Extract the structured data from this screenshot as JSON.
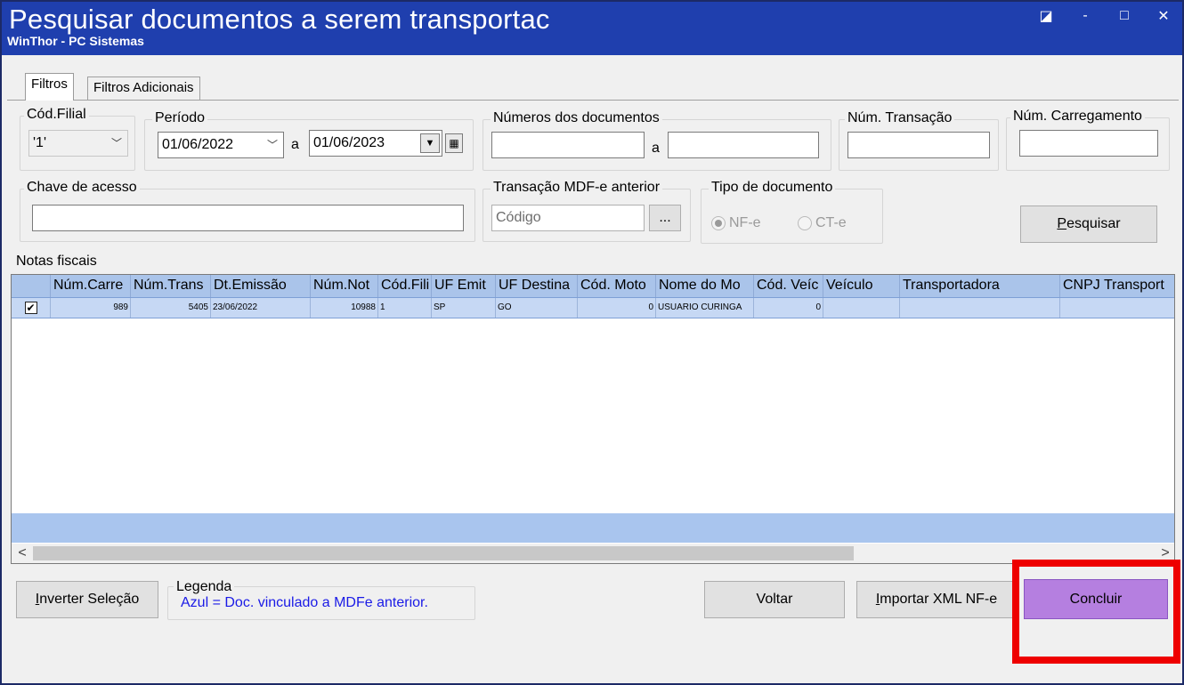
{
  "window": {
    "title": "Pesquisar documentos a serem transportac",
    "subtitle": "WinThor - PC Sistemas",
    "controls": {
      "restore": "◪",
      "minimize": "-",
      "maximize": "□",
      "close": "✕"
    }
  },
  "tabs": [
    {
      "label": "Filtros",
      "active": true
    },
    {
      "label": "Filtros Adicionais",
      "active": false
    }
  ],
  "filters": {
    "filial": {
      "label": "Cód.Filial",
      "value": "'1'"
    },
    "periodo": {
      "label": "Período",
      "start": "01/06/2022",
      "separator": "a",
      "end": "01/06/2023"
    },
    "numeros": {
      "label": "Números dos documentos",
      "from": "",
      "separator": "a",
      "to": ""
    },
    "transacao": {
      "label": "Núm. Transação",
      "value": ""
    },
    "carregamento": {
      "label": "Núm. Carregamento",
      "value": ""
    },
    "chave": {
      "label": "Chave de acesso",
      "value": ""
    },
    "mdfe": {
      "label": "Transação MDF-e anterior",
      "placeholder": "Código",
      "browse": "..."
    },
    "tipo": {
      "label": "Tipo de documento",
      "options": [
        {
          "label": "NF-e",
          "checked": true
        },
        {
          "label": "CT-e",
          "checked": false
        }
      ]
    },
    "pesquisar_prefix": "P",
    "pesquisar_rest": "esquisar"
  },
  "grid": {
    "label": "Notas fiscais",
    "columns": [
      "",
      "Núm.Carre",
      "Núm.Trans",
      "Dt.Emissão",
      "Núm.Not",
      "Cód.Fili",
      "UF Emit",
      "UF Destina",
      "Cód. Moto",
      "Nome do Mo",
      "Cód. Veíc",
      "Veículo",
      "Transportadora",
      "CNPJ Transport"
    ],
    "rows": [
      {
        "checked": true,
        "cells": [
          "989",
          "5405",
          "23/06/2022",
          "10988",
          "1",
          "SP",
          "GO",
          "0",
          "USUARIO CURINGA",
          "0",
          "",
          "",
          ""
        ]
      }
    ],
    "scroll_left": "<",
    "scroll_right": ">"
  },
  "footer": {
    "inverter_prefix": "I",
    "inverter_rest": "nverter Seleção",
    "legend": {
      "label": "Legenda",
      "text": "Azul = Doc. vinculado a MDFe anterior."
    },
    "voltar": "Voltar",
    "importar_prefix": "I",
    "importar_rest": "mportar XML NF-e",
    "concluir": "Concluir"
  },
  "colors": {
    "titlebar": "#1f3fae",
    "grid_header": "#aac4ea",
    "selected_row": "#c6d8f4",
    "legend_text": "#1a1ae6",
    "concluir_bg": "#b57fe0",
    "highlight": "#ee0000"
  }
}
